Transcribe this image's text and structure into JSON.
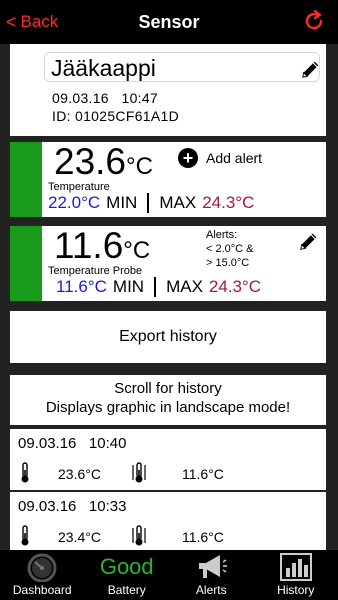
{
  "nav": {
    "back_label": "Back",
    "title": "Sensor"
  },
  "sensor": {
    "name": "Jääkaappi",
    "date": "09.03.16",
    "time": "10:47",
    "id_label": "ID:",
    "id": "01025CF61A1D"
  },
  "temperature": {
    "value": "23.6",
    "unit": "°C",
    "label": "Temperature",
    "min": "22.0°C",
    "min_label": "MIN",
    "max_label": "MAX",
    "max": "24.3°C",
    "add_alert": "Add alert"
  },
  "probe": {
    "value": "11.6",
    "unit": "°C",
    "label": "Temperature Probe",
    "min": "11.6°C",
    "min_label": "MIN",
    "max_label": "MAX",
    "max": "24.3°C",
    "alerts_title": "Alerts:",
    "alert_low": "< 2.0°C &",
    "alert_high": "> 15.0°C"
  },
  "export_label": "Export history",
  "scroll_hint": {
    "line1": "Scroll for history",
    "line2": "Displays graphic in landscape mode!"
  },
  "history": [
    {
      "date": "09.03.16",
      "time": "10:40",
      "temp": "23.6°C",
      "probe": "11.6°C"
    },
    {
      "date": "09.03.16",
      "time": "10:33",
      "temp": "23.4°C",
      "probe": "11.6°C"
    }
  ],
  "tabs": [
    {
      "label": "Dashboard",
      "icon": "gauge-icon"
    },
    {
      "label": "Battery",
      "status": "Good"
    },
    {
      "label": "Alerts",
      "icon": "megaphone-icon"
    },
    {
      "label": "History",
      "icon": "bar-chart-icon"
    }
  ],
  "colors": {
    "accent": "#ff2a2a",
    "indicator_green": "#1a9a1a",
    "min_blue": "#1c1cd8",
    "max_red": "#a01c3c",
    "battery_good": "#2bb52b"
  }
}
